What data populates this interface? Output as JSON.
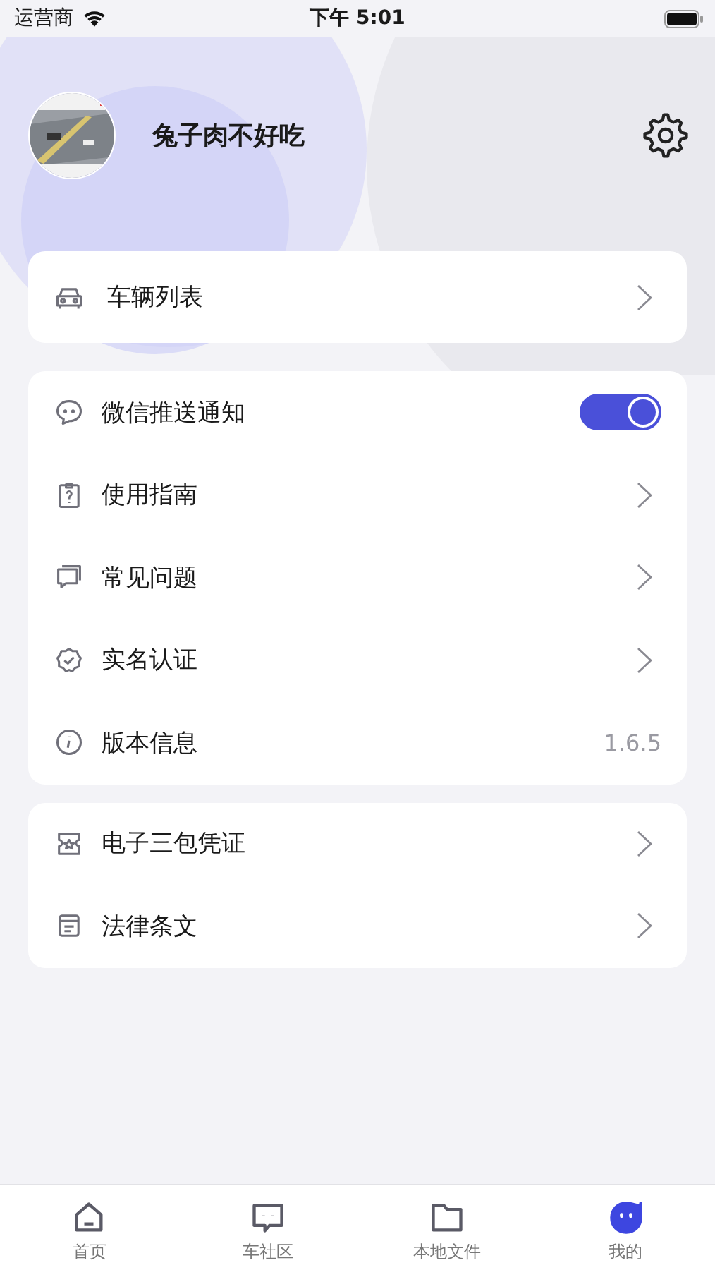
{
  "status_bar": {
    "carrier": "运营商",
    "time": "下午 5:01"
  },
  "profile": {
    "username": "兔子肉不好吃"
  },
  "menu_groups": [
    {
      "items": [
        {
          "label": "车辆列表",
          "kind": "chevron"
        }
      ]
    },
    {
      "items": [
        {
          "label": "微信推送通知",
          "kind": "toggle",
          "on": true
        },
        {
          "label": "使用指南",
          "kind": "chevron"
        },
        {
          "label": "常见问题",
          "kind": "chevron"
        },
        {
          "label": "实名认证",
          "kind": "chevron"
        },
        {
          "label": "版本信息",
          "kind": "value",
          "value": "1.6.5"
        }
      ]
    },
    {
      "items": [
        {
          "label": "电子三包凭证",
          "kind": "chevron"
        },
        {
          "label": "法律条文",
          "kind": "chevron"
        }
      ]
    }
  ],
  "tab_bar": [
    {
      "label": "首页",
      "selected": false
    },
    {
      "label": "车社区",
      "selected": false
    },
    {
      "label": "本地文件",
      "selected": false
    },
    {
      "label": "我的",
      "selected": true
    }
  ]
}
